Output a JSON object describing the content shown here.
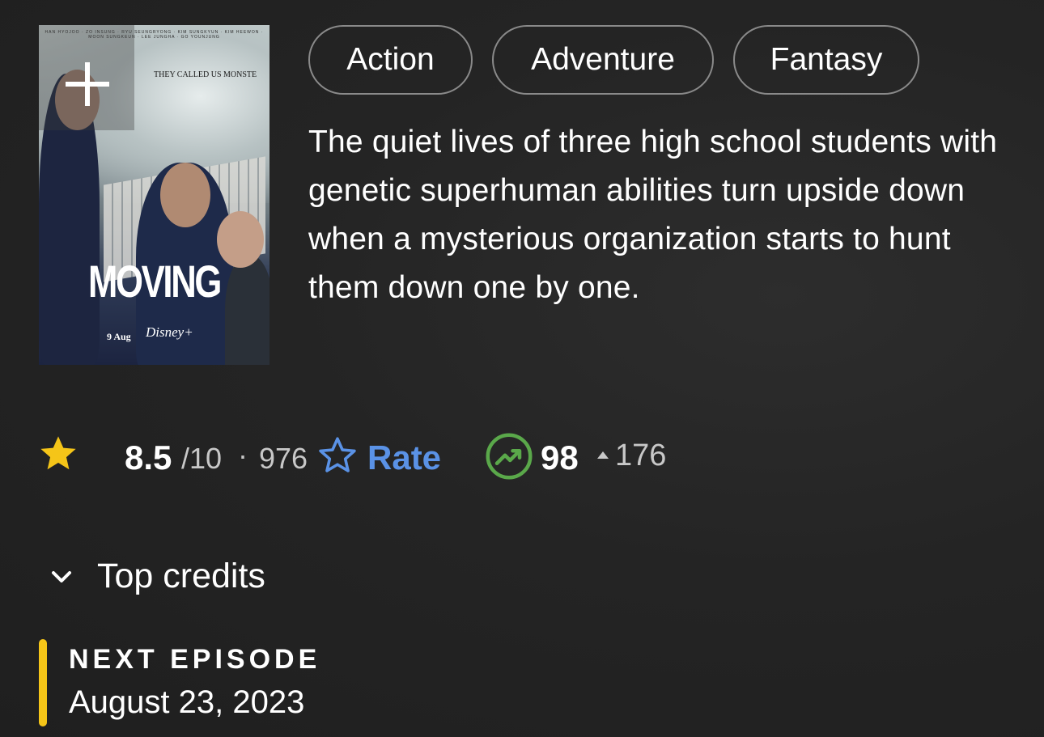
{
  "poster": {
    "credits_strip": "HAN HYOJOO · ZO INSUNG · RYU SEUNGRYONG · KIM SUNGKYUN · KIM HEEWON · MOON SUNGKEUN · LEE JUNGHA · GO YOUNJUNG",
    "tagline": "THEY CALLED US MONSTE",
    "title": "MOVING",
    "date": "9 Aug",
    "brand": "Disney+",
    "add_icon": "plus-icon"
  },
  "genres": [
    "Action",
    "Adventure",
    "Fantasy"
  ],
  "plot": "The quiet lives of three high school students with genetic superhuman abilities turn upside down when a mysterious organization starts to hunt them down one by one.",
  "rating": {
    "value": "8.5",
    "max": "/10",
    "separator": "·",
    "count": "976",
    "icon": "star-filled-icon",
    "color": "#f5c518"
  },
  "rate": {
    "label": "Rate",
    "icon": "star-outline-icon",
    "color": "#5a92e6"
  },
  "popularity": {
    "score": "98",
    "delta": "176",
    "icon": "trending-up-icon",
    "color": "#5aa84a"
  },
  "credits": {
    "label": "Top credits",
    "icon": "chevron-down-icon"
  },
  "next_episode": {
    "heading": "NEXT EPISODE",
    "date": "August 23, 2023",
    "accent": "#f5c518"
  }
}
